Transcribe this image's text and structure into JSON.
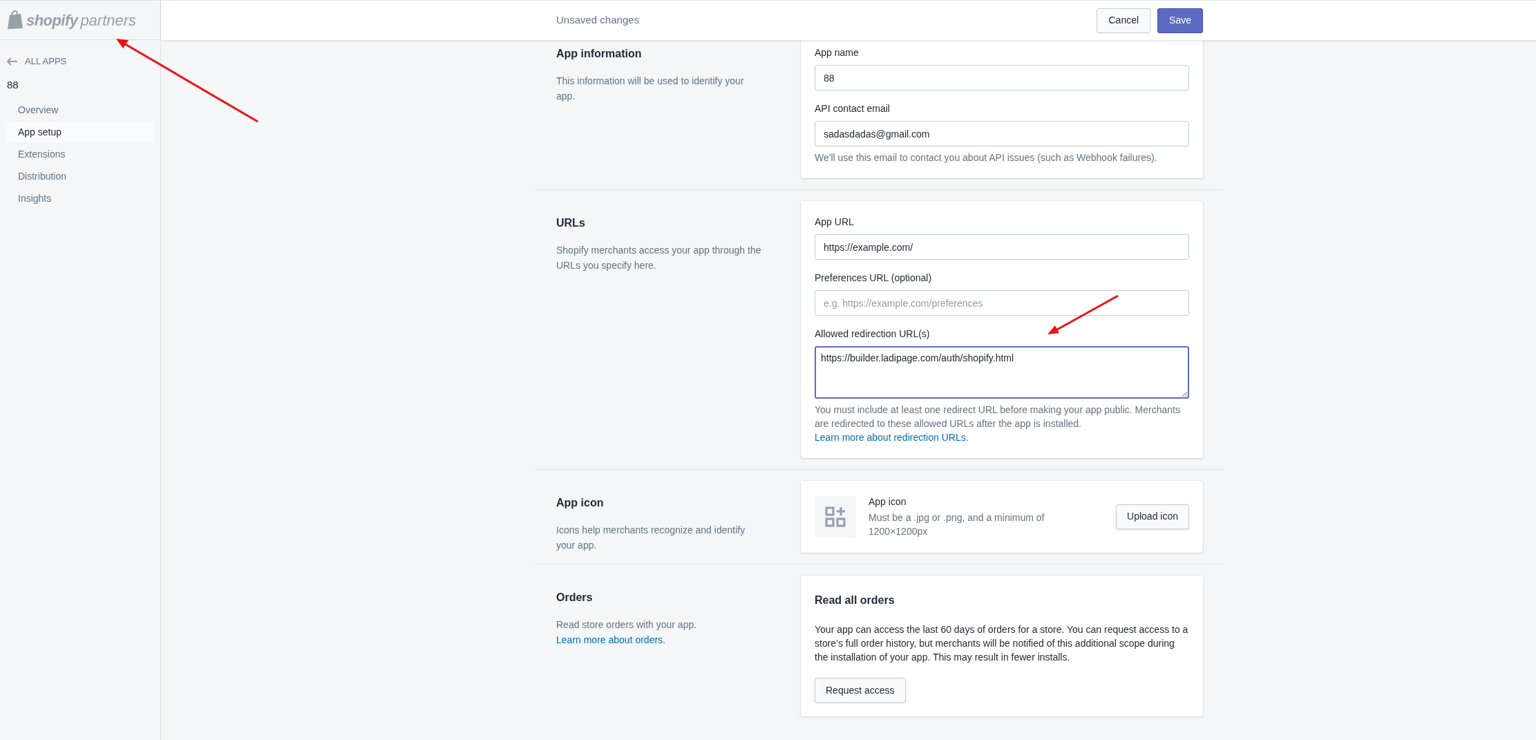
{
  "logo": {
    "word": "shopify",
    "suffix": "partners"
  },
  "sidebar": {
    "back": "ALL APPS",
    "app_name": "88",
    "items": [
      {
        "label": "Overview",
        "selected": false
      },
      {
        "label": "App setup",
        "selected": true
      },
      {
        "label": "Extensions",
        "selected": false
      },
      {
        "label": "Distribution",
        "selected": false
      },
      {
        "label": "Insights",
        "selected": false
      }
    ]
  },
  "top_bar": {
    "title": "Unsaved changes",
    "buttons": [
      {
        "label": "Cancel",
        "kind": "secondary"
      },
      {
        "label": "Save",
        "kind": "primary"
      }
    ]
  },
  "sections": [
    {
      "title": "App information",
      "description": {
        "text": "This information will be used to identify your app."
      },
      "card": {
        "kind": "fields",
        "fields": [
          {
            "label": "App name",
            "value": "88",
            "kind": "input",
            "focused": false
          },
          {
            "label": "API contact email",
            "value": "sadasdadas@gmail.com",
            "kind": "input",
            "focused": false,
            "help": {
              "text": "We'll use this email to contact you about API issues (such as Webhook failures)."
            }
          }
        ]
      }
    },
    {
      "title": "URLs",
      "description": {
        "text": "Shopify merchants access your app through the URLs you specify here."
      },
      "card": {
        "kind": "fields",
        "fields": [
          {
            "label": "App URL",
            "value": "https://example.com/",
            "kind": "input",
            "focused": false
          },
          {
            "label": "Preferences URL (optional)",
            "placeholder": "e.g. https://example.com/preferences",
            "kind": "input",
            "focused": false
          },
          {
            "label": "Allowed redirection URL(s)",
            "value": "https://builder.ladipage.com/auth/shopify.html",
            "kind": "textarea",
            "focused": true,
            "help": {
              "text": "You must include at least one redirect URL before making your app public. Merchants are redirected to these allowed URLs after the app is installed.",
              "link": "Learn more about redirection URLs."
            }
          }
        ]
      }
    },
    {
      "title": "App icon",
      "description": {
        "text": "Icons help merchants recognize and identify your app."
      },
      "card": {
        "kind": "icon_upload",
        "title": "App icon",
        "text": "Must be a .jpg or .png, and a minimum of 1200×1200px",
        "button": "Upload icon"
      }
    },
    {
      "title": "Orders",
      "description": {
        "text": "Read store orders with your app.",
        "link": "Learn more about orders."
      },
      "card": {
        "kind": "orders",
        "title": "Read all orders",
        "text": "Your app can access the last 60 days of orders for a store. You can request access to a store’s full order history, but merchants will be notified of this additional scope during the installation of your app. This may result in fewer installs.",
        "button": "Request access"
      }
    }
  ]
}
